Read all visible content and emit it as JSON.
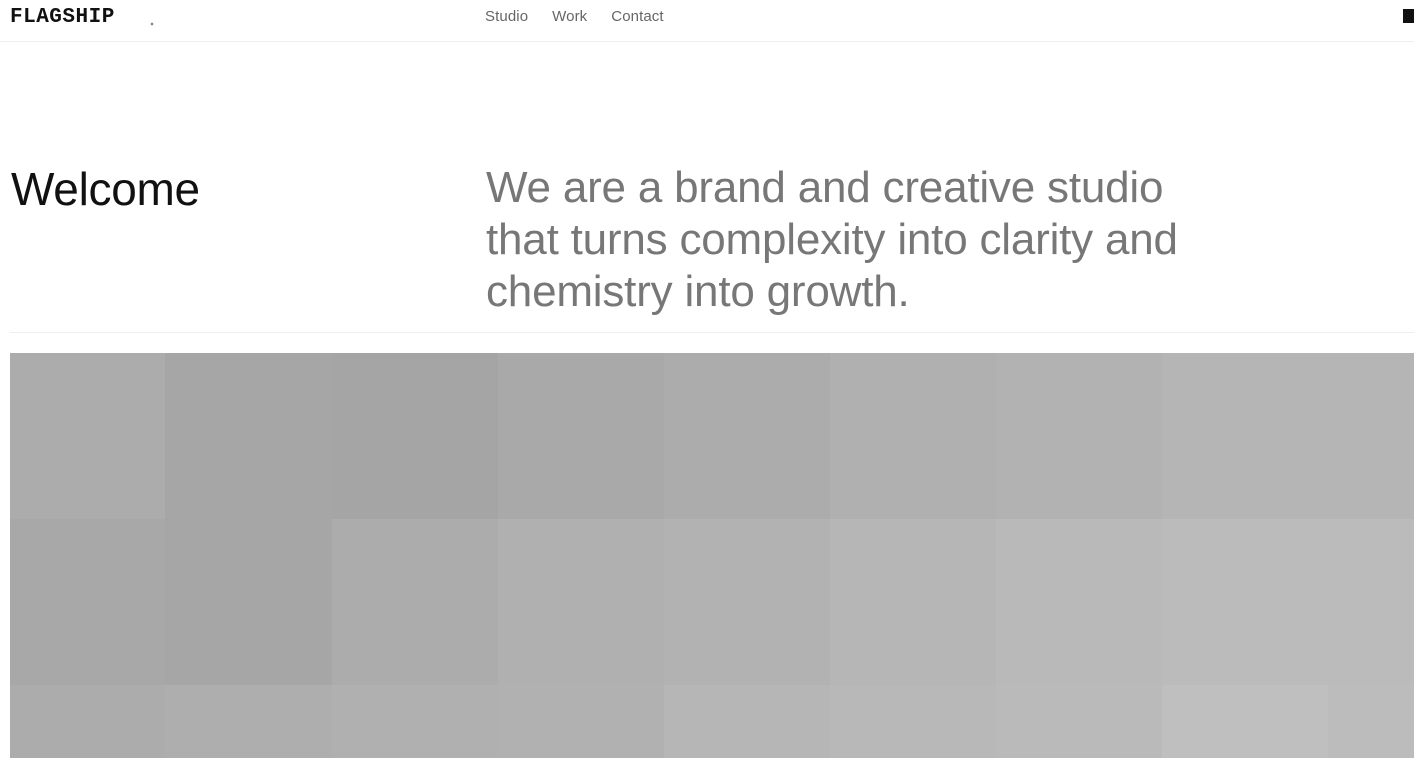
{
  "header": {
    "logo_text": "FLAGSHIP",
    "nav": [
      {
        "label": "Studio"
      },
      {
        "label": "Work"
      },
      {
        "label": "Contact"
      }
    ],
    "menu_icon": "square-menu-icon"
  },
  "main": {
    "welcome_heading": "Welcome",
    "intro_text": "We are a brand and creative studio that turns complexity into clarity and chemistry into growth."
  },
  "hero_image": {
    "description_icon": "image-placeholder",
    "tiles": [
      [
        "#acacac",
        "#a6a6a6",
        "#a5a5a5",
        "#a9a9a9",
        "#acacac",
        "#b0b0b0",
        "#b2b2b2",
        "#b5b5b5",
        "#b5b5b5"
      ],
      [
        "#a8a8a8",
        "#a6a6a6",
        "#acacac",
        "#b0b0b0",
        "#b2b2b2",
        "#b6b6b6",
        "#b9b9b9",
        "#bbbbbb",
        "#bbbbbb"
      ],
      [
        "#acacac",
        "#aeaeae",
        "#b0b0b0",
        "#b1b1b1",
        "#b6b6b6",
        "#b8b8b8",
        "#bababa",
        "#bfbfbf",
        "#bcbcbc"
      ]
    ]
  },
  "colors": {
    "text_primary": "#111111",
    "text_muted": "#777777",
    "nav_text": "#666666",
    "divider": "#eeeeee",
    "background": "#ffffff"
  }
}
